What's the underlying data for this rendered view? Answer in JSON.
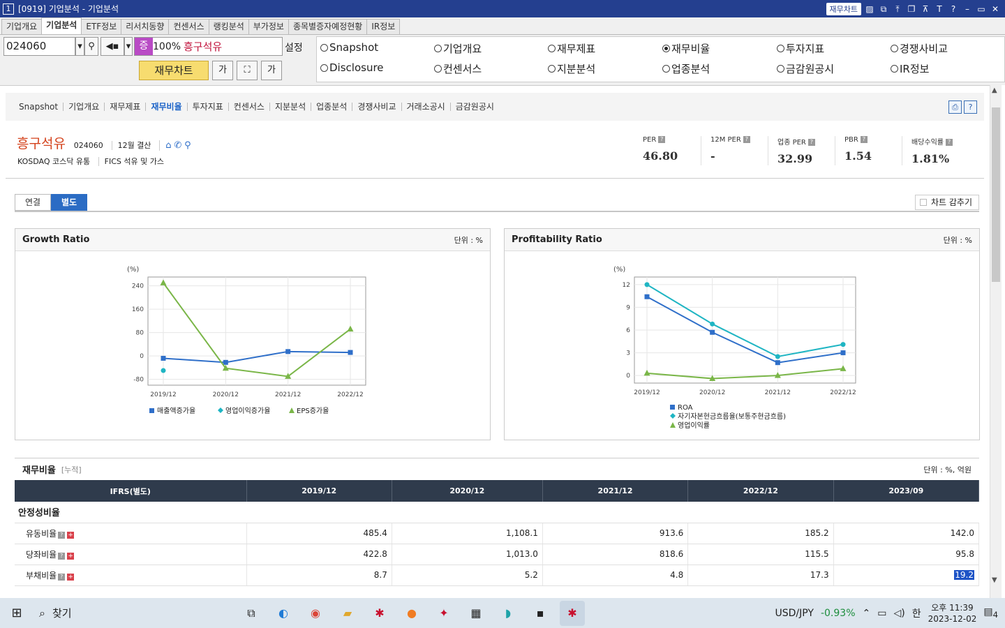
{
  "window": {
    "app_number": "1",
    "title": "[0919] 기업분석 - 기업분석",
    "pill_label": "재무차트"
  },
  "menu_tabs": [
    "기업개요",
    "기업분석",
    "ETF정보",
    "리서치동향",
    "컨센서스",
    "랭킹분석",
    "부가정보",
    "종목별증자예정현황",
    "IR정보"
  ],
  "toolbar": {
    "code_value": "024060",
    "market_badge": "증",
    "zoom": "100%",
    "stock_name": "흥구석유",
    "settings_label": "설정",
    "chart_button": "재무차트",
    "font_btn_1": "가",
    "font_btn_2": "가"
  },
  "radio_options": [
    {
      "label": "Snapshot",
      "selected": false
    },
    {
      "label": "기업개요",
      "selected": false
    },
    {
      "label": "재무제표",
      "selected": false
    },
    {
      "label": "재무비율",
      "selected": true
    },
    {
      "label": "투자지표",
      "selected": false
    },
    {
      "label": "경쟁사비교",
      "selected": false
    },
    {
      "label": "Disclosure",
      "selected": false
    },
    {
      "label": "컨센서스",
      "selected": false
    },
    {
      "label": "지분분석",
      "selected": false
    },
    {
      "label": "업종분석",
      "selected": false
    },
    {
      "label": "금감원공시",
      "selected": false
    },
    {
      "label": "IR정보",
      "selected": false
    }
  ],
  "subnav": [
    "Snapshot",
    "기업개요",
    "재무제표",
    "재무비율",
    "투자지표",
    "컨센서스",
    "지분분석",
    "업종분석",
    "경쟁사비교",
    "거래소공시",
    "금감원공시"
  ],
  "subnav_active": "재무비율",
  "company": {
    "name": "흥구석유",
    "code": "024060",
    "fiscal": "12월 결산",
    "market_line": "KOSDAQ  코스닥 유통",
    "fics_line": "FICS 석유 및 가스"
  },
  "metrics": [
    {
      "label": "PER",
      "value": "46.80"
    },
    {
      "label": "12M PER",
      "value": "-"
    },
    {
      "label": "업종 PER",
      "value": "32.99"
    },
    {
      "label": "PBR",
      "value": "1.54"
    },
    {
      "label": "배당수익률",
      "value": "1.81%"
    }
  ],
  "report_tabs": {
    "consolidated": "연결",
    "separate": "별도"
  },
  "hide_chart_label": "차트 감추기",
  "colors": {
    "series_blue": "#2f6fc9",
    "series_cyan": "#1fb5c3",
    "series_green": "#7ab648",
    "header_dark": "#2f3b4c",
    "accent_red": "#d4431d"
  },
  "growth_panel": {
    "title": "Growth Ratio",
    "unit": "단위 : %"
  },
  "profit_panel": {
    "title": "Profitability Ratio",
    "unit": "단위 : %"
  },
  "chart_data": [
    {
      "type": "line",
      "title": "Growth Ratio",
      "ylabel": "(%)",
      "categories": [
        "2019/12",
        "2020/12",
        "2021/12",
        "2022/12"
      ],
      "yticks": [
        -80,
        0,
        80,
        160,
        240
      ],
      "ylim": [
        -100,
        270
      ],
      "series": [
        {
          "name": "매출액증가율",
          "color": "#2f6fc9",
          "marker": "square",
          "values": [
            -8,
            -22,
            15,
            12
          ]
        },
        {
          "name": "영업이익증가율",
          "color": "#1fb5c3",
          "marker": "diamond",
          "values": [
            -50,
            null,
            null,
            null
          ]
        },
        {
          "name": "EPS증가율",
          "color": "#7ab648",
          "marker": "triangle",
          "values": [
            250,
            -42,
            -70,
            92
          ]
        }
      ],
      "legend": "bottom"
    },
    {
      "type": "line",
      "title": "Profitability Ratio",
      "ylabel": "(%)",
      "categories": [
        "2019/12",
        "2020/12",
        "2021/12",
        "2022/12"
      ],
      "yticks": [
        0,
        3,
        6,
        9,
        12
      ],
      "ylim": [
        -1,
        13
      ],
      "series": [
        {
          "name": "ROA",
          "color": "#2f6fc9",
          "marker": "square",
          "values": [
            10.4,
            5.7,
            1.7,
            3.0
          ]
        },
        {
          "name": "자기자본현금흐름율(보통주현금흐름)",
          "color": "#1fb5c3",
          "marker": "diamond",
          "values": [
            12.0,
            6.8,
            2.5,
            4.1
          ]
        },
        {
          "name": "영업이익률",
          "color": "#7ab648",
          "marker": "triangle",
          "values": [
            0.3,
            -0.4,
            0.0,
            0.9
          ]
        }
      ],
      "legend": "bottom"
    }
  ],
  "ratio_section": {
    "title": "재무비율",
    "accum": "[누적]",
    "unit": "단위 : %, 억원"
  },
  "ratio_table": {
    "header": [
      "IFRS(별도)",
      "2019/12",
      "2020/12",
      "2021/12",
      "2022/12",
      "2023/09"
    ],
    "group": "안정성비율",
    "rows": [
      {
        "label": "유동비율",
        "values": [
          "485.4",
          "1,108.1",
          "913.6",
          "185.2",
          "142.0"
        ]
      },
      {
        "label": "당좌비율",
        "values": [
          "422.8",
          "1,013.0",
          "818.6",
          "115.5",
          "95.8"
        ]
      },
      {
        "label": "부채비율",
        "values": [
          "8.7",
          "5.2",
          "4.8",
          "17.3",
          "19.2"
        ]
      }
    ]
  },
  "taskbar": {
    "search_label": "찾기",
    "fx_pair": "USD/JPY",
    "fx_change": "-0.93%",
    "ime": "한",
    "time": "오후 11:39",
    "date": "2023-12-02",
    "notifications": "4"
  }
}
